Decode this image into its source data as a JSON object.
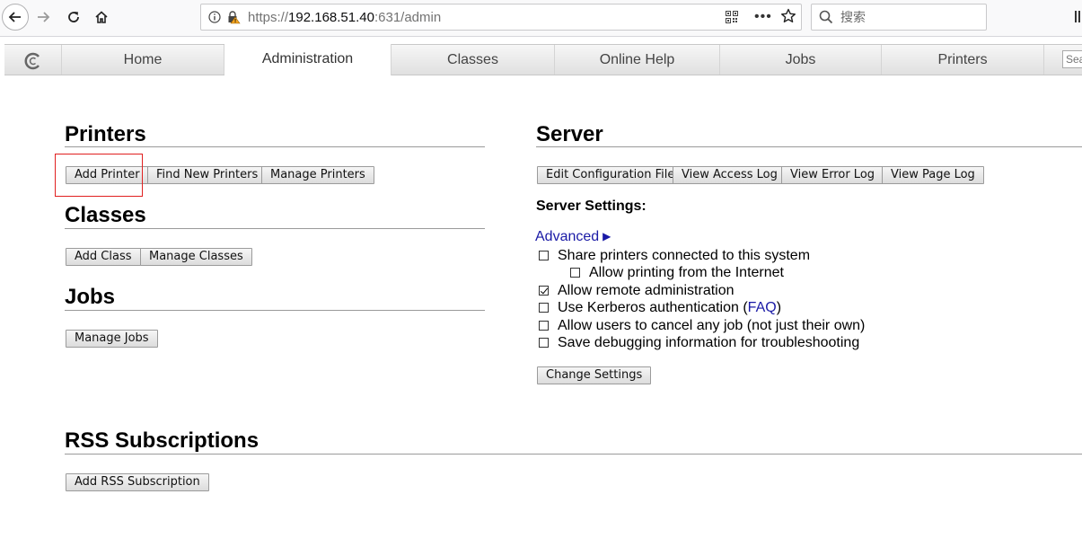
{
  "browser": {
    "url_prefix": "https://",
    "url_host": "192.168.51.40",
    "url_rest": ":631/admin",
    "more_label": "•••",
    "search_placeholder": "搜索"
  },
  "tabs": {
    "home": "Home",
    "administration": "Administration",
    "classes": "Classes",
    "online_help": "Online Help",
    "jobs": "Jobs",
    "printers": "Printers",
    "search_placeholder": "Search"
  },
  "printers": {
    "heading": "Printers",
    "add_printer": "Add Printer",
    "find_new": "Find New Printers",
    "manage": "Manage Printers"
  },
  "classes": {
    "heading": "Classes",
    "add_class": "Add Class",
    "manage": "Manage Classes"
  },
  "jobs": {
    "heading": "Jobs",
    "manage": "Manage Jobs"
  },
  "server": {
    "heading": "Server",
    "edit_config": "Edit Configuration File",
    "view_access_log": "View Access Log",
    "view_error_log": "View Error Log",
    "view_page_log": "View Page Log",
    "settings_label": "Server Settings:",
    "advanced": "Advanced",
    "options": {
      "share_printers": {
        "label": "Share printers connected to this system",
        "checked": false
      },
      "allow_internet": {
        "label": "Allow printing from the Internet",
        "checked": false
      },
      "remote_admin": {
        "label": "Allow remote administration",
        "checked": true
      },
      "kerberos": {
        "label": "Use Kerberos authentication (",
        "link": "FAQ",
        "suffix": ")",
        "checked": false
      },
      "cancel_any": {
        "label": "Allow users to cancel any job (not just their own)",
        "checked": false
      },
      "debug": {
        "label": "Save debugging information for troubleshooting",
        "checked": false
      }
    },
    "change_settings": "Change Settings"
  },
  "rss": {
    "heading": "RSS Subscriptions",
    "add": "Add RSS Subscription"
  }
}
